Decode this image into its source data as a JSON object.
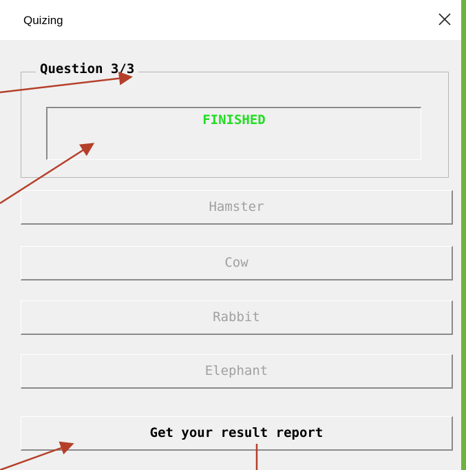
{
  "window": {
    "title": "Quizing"
  },
  "question": {
    "heading": "Question 3/3",
    "status_text": "FINISHED"
  },
  "answers": [
    {
      "label": "Hamster",
      "enabled": false
    },
    {
      "label": "Cow",
      "enabled": false
    },
    {
      "label": "Rabbit",
      "enabled": false
    },
    {
      "label": "Elephant",
      "enabled": false
    }
  ],
  "report_button": {
    "label": "Get your result report"
  },
  "icons": {
    "close": "close-icon"
  },
  "colors": {
    "status_text": "#22dd22",
    "disabled_text": "#a0a0a0",
    "annotation_arrow": "#b5402a",
    "edge_accent": "#6db33f"
  }
}
